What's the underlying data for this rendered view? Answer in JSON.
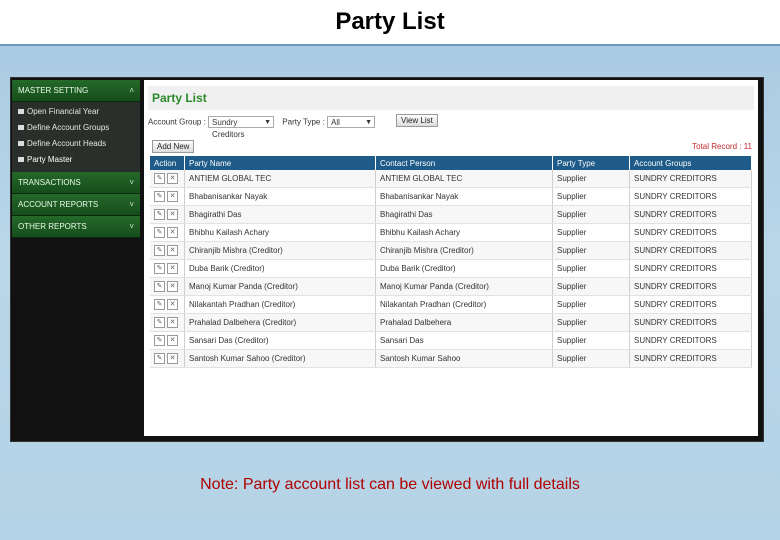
{
  "slide": {
    "title": "Party List",
    "note": "Note: Party account list can be viewed with full details"
  },
  "sidebar": {
    "sections": [
      {
        "label": "MASTER SETTING",
        "expanded": true
      },
      {
        "label": "TRANSACTIONS"
      },
      {
        "label": "ACCOUNT REPORTS"
      },
      {
        "label": "OTHER REPORTS"
      }
    ],
    "items": [
      {
        "label": "Open Financial Year"
      },
      {
        "label": "Define Account Groups"
      },
      {
        "label": "Define Account Heads"
      },
      {
        "label": "Party Master"
      }
    ]
  },
  "page": {
    "heading": "Party List",
    "account_group_label": "Account Group :",
    "account_group_value": "Sundry Creditors",
    "party_type_label": "Party Type :",
    "party_type_value": "All",
    "view_button": "View List",
    "add_button": "Add New",
    "total_record": "Total Record : 11"
  },
  "table": {
    "headers": [
      "Action",
      "Party Name",
      "Contact Person",
      "Party Type",
      "Account Groups"
    ],
    "rows": [
      [
        "ANTIEM GLOBAL TEC",
        "ANTIEM GLOBAL TEC",
        "Supplier",
        "SUNDRY CREDITORS"
      ],
      [
        "Bhabanisankar Nayak",
        "Bhabanisankar Nayak",
        "Supplier",
        "SUNDRY CREDITORS"
      ],
      [
        "Bhagirathi Das",
        "Bhagirathi Das",
        "Supplier",
        "SUNDRY CREDITORS"
      ],
      [
        "Bhibhu Kailash Achary",
        "Bhibhu Kailash Achary",
        "Supplier",
        "SUNDRY CREDITORS"
      ],
      [
        "Chiranjib Mishra (Creditor)",
        "Chiranjib Mishra (Creditor)",
        "Supplier",
        "SUNDRY CREDITORS"
      ],
      [
        "Duba Barik (Creditor)",
        "Duba Barik (Creditor)",
        "Supplier",
        "SUNDRY CREDITORS"
      ],
      [
        "Manoj Kumar Panda (Creditor)",
        "Manoj Kumar Panda (Creditor)",
        "Supplier",
        "SUNDRY CREDITORS"
      ],
      [
        "Nilakantah Pradhan (Creditor)",
        "Nilakantah Pradhan (Creditor)",
        "Supplier",
        "SUNDRY CREDITORS"
      ],
      [
        "Prahalad Dalbehera (Creditor)",
        "Prahalad Dalbehera",
        "Supplier",
        "SUNDRY CREDITORS"
      ],
      [
        "Sansari Das (Creditor)",
        "Sansari Das",
        "Supplier",
        "SUNDRY CREDITORS"
      ],
      [
        "Santosh Kumar Sahoo (Creditor)",
        "Santosh Kumar Sahoo",
        "Supplier",
        "SUNDRY CREDITORS"
      ]
    ]
  },
  "icons": {
    "edit": "pencil-icon",
    "delete": "delete-icon",
    "expand": "chevron-icon"
  },
  "colors": {
    "header": "#1f5b88",
    "sidebar": "#24692a",
    "heading": "#2a8a2a",
    "note": "#b00000"
  }
}
